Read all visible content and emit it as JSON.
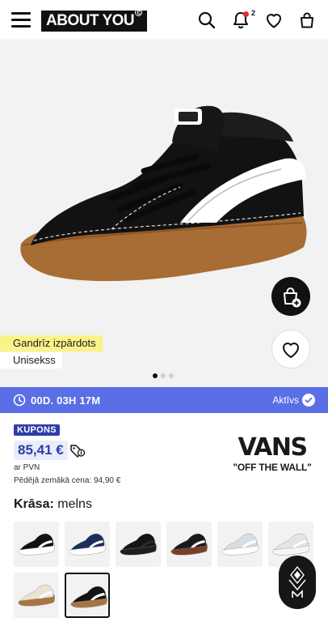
{
  "header": {
    "logo_text": "ABOUT YOU",
    "notifications_count": "2"
  },
  "product": {
    "tag_primary": "Gandrīz izpārdots",
    "tag_secondary": "Unisekss",
    "image_dots_total": 3,
    "image_dots_active": 1
  },
  "countdown": {
    "time": "00D. 03H 17M",
    "status": "Aktīvs"
  },
  "pricing": {
    "coupon_label": "KUPONS",
    "price": "85,41 €",
    "vat_note": "ar PVN",
    "lowest_price_note": "Pēdējā zemākā cena:  94,90 €"
  },
  "brand": {
    "name": "VANS",
    "slogan": "\"OFF THE WALL\""
  },
  "color": {
    "label": "Krāsa:",
    "value": "melns"
  },
  "swatches": [
    {
      "name": "black-white",
      "upper": "#111111",
      "sole": "#ffffff",
      "stripe": "#ffffff"
    },
    {
      "name": "navy-white",
      "upper": "#1d2d5c",
      "sole": "#ffffff",
      "stripe": "#ffffff"
    },
    {
      "name": "all-black",
      "upper": "#141414",
      "sole": "#1e1e1e",
      "stripe": "#2a2a2a"
    },
    {
      "name": "brown-black",
      "upper": "#1a1a1a",
      "sole": "#7a3e2a",
      "stripe": "#ffffff"
    },
    {
      "name": "light-blue",
      "upper": "#d6dde3",
      "sole": "#ffffff",
      "stripe": "#ffffff"
    },
    {
      "name": "light-grey",
      "upper": "#e5e5e2",
      "sole": "#f5f5f5",
      "stripe": "#ffffff"
    },
    {
      "name": "cream-gum",
      "upper": "#ebe4d2",
      "sole": "#a87542",
      "stripe": "#ffffff"
    },
    {
      "name": "black-gum",
      "upper": "#131313",
      "sole": "#a87542",
      "stripe": "#ffffff",
      "selected": true
    }
  ],
  "colors": {
    "accent": "#5a6ee6",
    "coupon": "#2e3da8",
    "tag_yellow": "#fbf38a"
  }
}
